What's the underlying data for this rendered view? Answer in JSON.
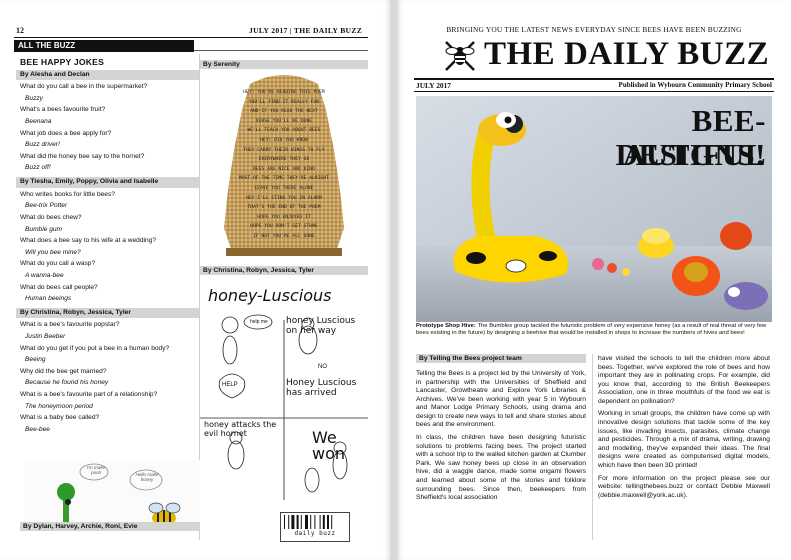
{
  "left_page": {
    "page_number": "12",
    "header": "JULY 2017 | THE DAILY BUZZ",
    "section_bar": "ALL THE BUZZ",
    "jokes_title": "BEE HAPPY JOKES",
    "groups": [
      {
        "by": "By Alesha and Declan",
        "jokes": [
          {
            "q": "What do you call a bee in the supermarket?",
            "a": "Buzzy"
          },
          {
            "q": "What's a bees favourite fruit?",
            "a": "Beenana"
          },
          {
            "q": "What job does a bee apply for?",
            "a": "Buzz driver!"
          },
          {
            "q": "What did the honey bee say to the hornet?",
            "a": "Buzz off!"
          }
        ]
      },
      {
        "by": "By Tiesha, Emily, Poppy, Olivia and Isabelle",
        "jokes": [
          {
            "q": "Who writes books for little bees?",
            "a": "Bee-trix Potter"
          },
          {
            "q": "What do bees chew?",
            "a": "Bumble gum"
          },
          {
            "q": "What does a bee say to his wife at a wedding?",
            "a": "Will you bee mine?"
          },
          {
            "q": "What do you call a wasp?",
            "a": "A wanna-bee"
          },
          {
            "q": "What do bees call people?",
            "a": "Human beeings"
          }
        ]
      },
      {
        "by": "By Christina, Robyn, Jessica, Tyler",
        "jokes": [
          {
            "q": "What is a bee's favourite popstar?",
            "a": "Justin Beeber"
          },
          {
            "q": "What do you get if you put a bee in a human body?",
            "a": "Beeing"
          },
          {
            "q": "Why did the bee get married?",
            "a": "Because he found his honey"
          },
          {
            "q": "What is a bee's favourite part of a relationship?",
            "a": "The honeymoon period"
          },
          {
            "q": "What is a baby bee called?",
            "a": "Bee-bee"
          }
        ]
      }
    ],
    "bottom_credit": "By Dylan, Harvey, Archie, Roni, Evie",
    "serenity_caption": "By Serenity",
    "poem_lines": [
      "HEY! YOU'RE READING THIS POEM",
      "YOU'LL FIND IT REALLY FUN",
      "AND IF YOU READ THE NEXT",
      "VERSE YOU'LL BE DONE",
      "WE'LL TEACH YOU ABOUT BEES",
      "HEY! DID YOU KNOW",
      "THEY CARRY THEIR WINGS TO FLY",
      "EVERYWHERE THEY GO",
      "BEES ARE NICE AND KIND",
      "MOST OF THE TIME THEY'RE ALRIGHT",
      "LEAVE YOU THERE ALONE",
      "HEY I'LL STING YOU IN ALARM",
      "THAT'S THE END OF THE POEM",
      "HOPE YOU ENJOYED IT",
      "HOPE YOU DON'T GET STUNG",
      "IF NOT YOU'RE ALL DONE"
    ],
    "comic_caption": "By Christina, Robyn, Jessica, Tyler",
    "comic_title": "honey-Luscious",
    "comic_panels": [
      "honey Luscious on her way",
      "Honey Luscious has arrived",
      "honey attacks the evil hornet",
      "We won"
    ],
    "comic_bubbles": [
      "help me",
      "HELP",
      "NO"
    ],
    "bee_bubbles": [
      "I'm make pool!",
      "Hello make honey"
    ],
    "barcode_text": "daily buzz"
  },
  "right_page": {
    "tagline": "BRINGING YOU THE LATEST NEWS EVERYDAY SINCE BEES HAVE BEEN BUZZING",
    "masthead": "THE DAILY BUZZ",
    "date": "JULY 2017",
    "publisher": "Published in Wybourn Community Primary School",
    "headline_line1": "BEE-AUTIFUL",
    "headline_line2": "DESIGNS!",
    "photo_caption_bold": "Prototype Shop Hive:",
    "photo_caption": "The Bumbles group tackled the futuristic problem of very expensive honey (as a result of real threat of very few bees existing in the future) by designing a beehive that would be installed in shops to increase the numbers of hives and bees!",
    "byline": "By Telling the Bees project team",
    "col1": [
      "Telling the Bees is a project led by the University of York, in partnership with the Universities of Sheffield and Lancaster, Growtheatre and Explore York Libraries & Archives. We've been working with year 5 in Wybourn and Manor Lodge Primary Schools, using drama and design to create new ways to tell and share stories about bees and the environment.",
      "In class, the children have been designing futuristic solutions to problems facing bees. The project started with a school trip to the walled kitchen garden at Clumber Park. We saw honey bees up close in an observation hive, did a waggle dance, made some origami flowers and learned about some of the stories and folklore surrounding bees. Since then, beekeepers from Sheffield's local association"
    ],
    "col2": [
      "have visited the schools to tell the children more about bees. Together, we've explored the role of bees and how important they are in pollinating crops. For example, did you know that, according to the British Beekeepers Association, one in three mouthfuls of the food we eat is dependent on pollination?",
      "Working in small groups, the children have come up with innovative design solutions that tackle some of the key issues, like invading insects, parasites, climate change and pesticides. Through a mix of drama, writing, drawing and modelling, they've expanded their ideas. The final designs were created as computerised digital models, which have then been 3D printed!",
      "For more information on the project please see our website: tellingthebees.buzz or contact Debbie Maxwell (debbie.maxwell@york.ac.uk)."
    ]
  }
}
